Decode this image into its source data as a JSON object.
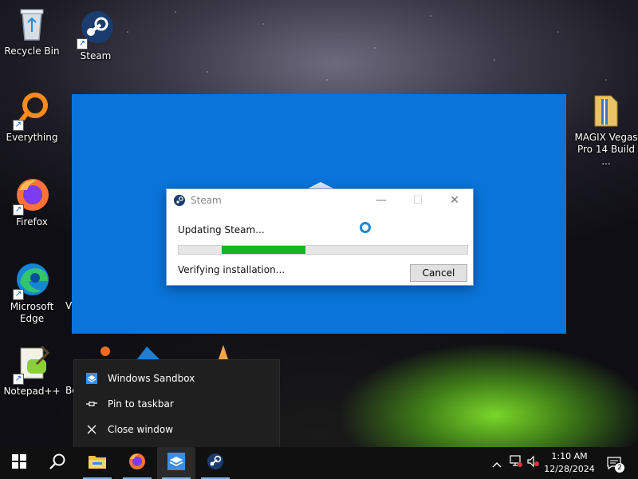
{
  "desktop": {
    "icons": [
      {
        "label": "Recycle Bin"
      },
      {
        "label": "Steam"
      },
      {
        "label": "Everything"
      },
      {
        "label": "Firefox"
      },
      {
        "label": "Microsoft Edge"
      },
      {
        "label": "Notepad++"
      },
      {
        "label": "MAGIX Vegas Pro 14 Build ..."
      }
    ],
    "partial_labels": [
      "V",
      "Be"
    ]
  },
  "steam_dialog": {
    "title": "Steam",
    "status": "Updating Steam...",
    "progress": 0.44,
    "progress_start": 0.15,
    "substatus": "Verifying installation...",
    "cancel_label": "Cancel",
    "minimize_glyph": "—",
    "maximize_glyph": "☐",
    "close_glyph": "✕"
  },
  "jumplist": {
    "items": [
      {
        "label": "Windows Sandbox"
      },
      {
        "label": "Pin to taskbar"
      },
      {
        "label": "Close window"
      }
    ]
  },
  "taskbar": {
    "apps": [
      "start-button",
      "search-button",
      "file-explorer",
      "firefox",
      "windows-sandbox",
      "steam"
    ],
    "active": "windows-sandbox",
    "clock_time": "1:10 AM",
    "clock_date": "12/28/2024",
    "notification_count": "2"
  },
  "colors": {
    "sandbox_blue": "#0a74da",
    "progress_green": "#10b52a",
    "taskbar": "#101010"
  }
}
